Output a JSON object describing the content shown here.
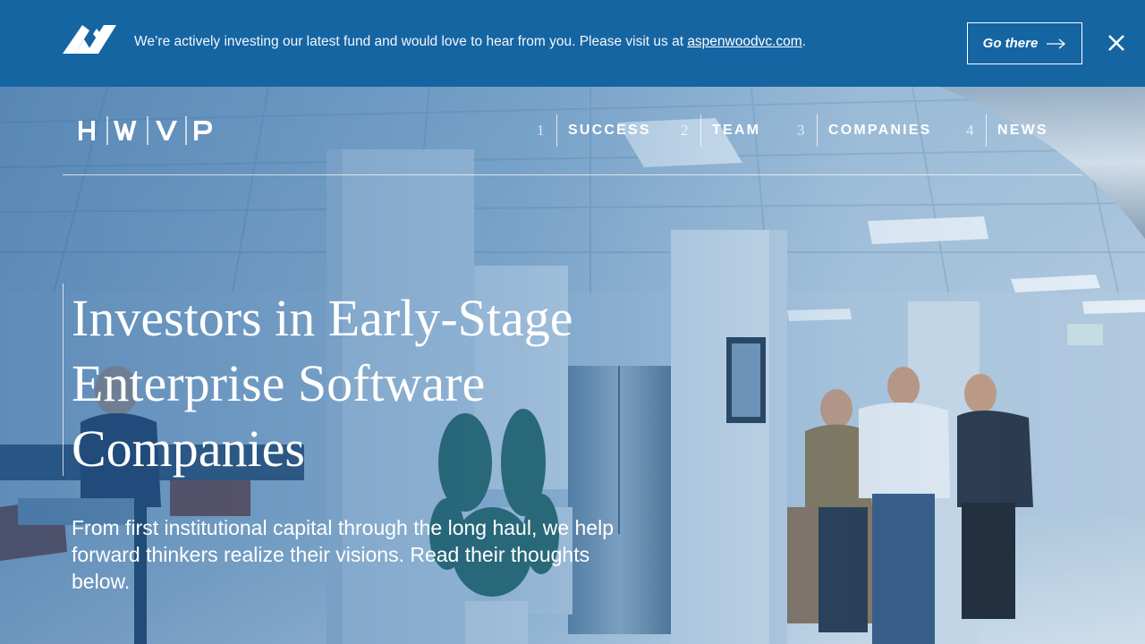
{
  "announcement": {
    "text_before": "We’re actively investing our latest fund and would love to hear from you. Please visit us at ",
    "link_text": "aspenwoodvc.com",
    "text_after": ".",
    "cta_label": "Go there",
    "logo_icon": "aspenwood-logo-icon",
    "close_icon": "close-icon",
    "background_color": "#1565a3"
  },
  "header": {
    "brand_letters": [
      "H",
      "W",
      "V",
      "P"
    ],
    "nav": [
      {
        "num": "1",
        "label": "SUCCESS"
      },
      {
        "num": "2",
        "label": "TEAM"
      },
      {
        "num": "3",
        "label": "COMPANIES"
      },
      {
        "num": "4",
        "label": "NEWS"
      }
    ]
  },
  "hero": {
    "headline": "Investors in Early-Stage Enterprise Software Companies",
    "subhead": "From first institutional capital through the long haul, we help forward thinkers realize their visions. Read their thoughts below."
  }
}
